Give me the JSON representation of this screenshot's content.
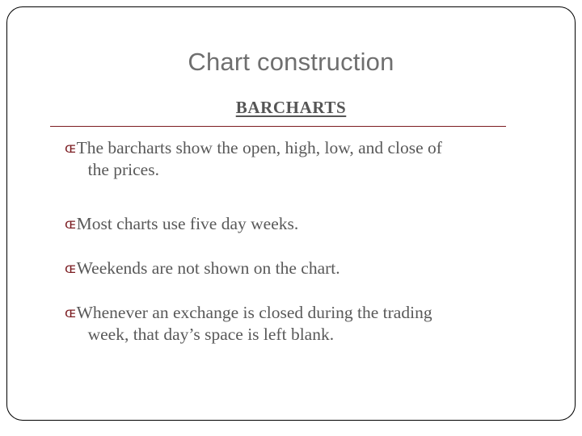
{
  "slide": {
    "title": "Chart construction",
    "subtitle": "BARCHARTS",
    "bullet_glyph": "ɶ",
    "accent_color": "#7b1c21",
    "title_color": "#6f6f6f",
    "body_color": "#595959",
    "bullets": [
      {
        "line1": "The barcharts show the open, high, low, and close of",
        "line2": "the prices."
      },
      {
        "line1": "Most charts use five day weeks.",
        "line2": ""
      },
      {
        "line1": "Weekends are not shown on the chart.",
        "line2": ""
      },
      {
        "line1": "Whenever an exchange is closed during the trading",
        "line2": "week, that day’s space is left blank."
      }
    ]
  }
}
